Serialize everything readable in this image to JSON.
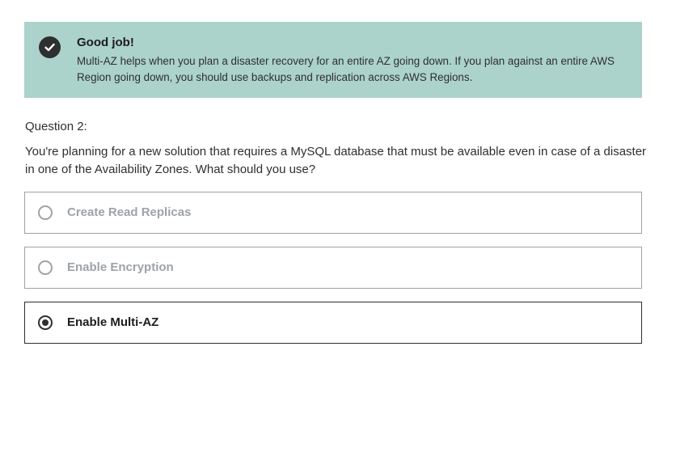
{
  "feedback": {
    "title": "Good job!",
    "message": "Multi-AZ helps when you plan a disaster recovery for an entire AZ going down. If you plan against an entire AWS Region going down, you should use backups and replication across AWS Regions.",
    "icon": "check-circle-icon",
    "background_color": "#acd2cc"
  },
  "question": {
    "number_label": "Question 2:",
    "text": "You're planning for a new solution that requires a MySQL database that must be available even in case of a disaster in one of the Availability Zones. What should you use?",
    "options": [
      {
        "label": "Create Read Replicas",
        "selected": false
      },
      {
        "label": "Enable Encryption",
        "selected": false
      },
      {
        "label": "Enable Multi-AZ",
        "selected": true
      }
    ]
  }
}
